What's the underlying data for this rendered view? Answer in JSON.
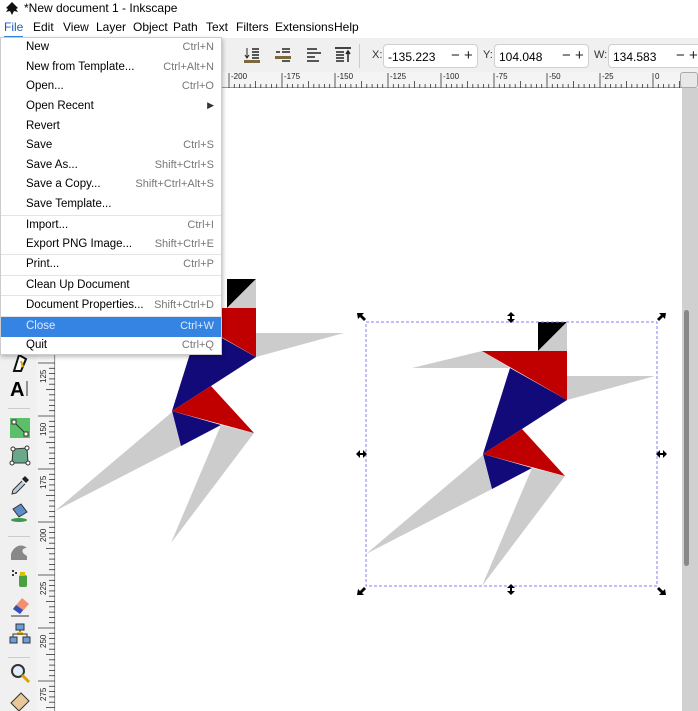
{
  "window": {
    "title": "*New document 1 - Inkscape"
  },
  "menubar": [
    "File",
    "Edit",
    "View",
    "Layer",
    "Object",
    "Path",
    "Text",
    "Filters",
    "Extensions",
    "Help"
  ],
  "file_menu": [
    {
      "label": "New",
      "shortcut": "Ctrl+N"
    },
    {
      "label": "New from Template...",
      "shortcut": "Ctrl+Alt+N"
    },
    {
      "label": "Open...",
      "shortcut": "Ctrl+O"
    },
    {
      "label": "Open Recent",
      "shortcut": "▶"
    },
    {
      "label": "Revert",
      "shortcut": ""
    },
    {
      "label": "Save",
      "shortcut": "Ctrl+S"
    },
    {
      "label": "Save As...",
      "shortcut": "Shift+Ctrl+S"
    },
    {
      "label": "Save a Copy...",
      "shortcut": "Shift+Ctrl+Alt+S"
    },
    {
      "label": "Save Template...",
      "shortcut": ""
    },
    {
      "label": "Import...",
      "shortcut": "Ctrl+I"
    },
    {
      "label": "Export PNG Image...",
      "shortcut": "Shift+Ctrl+E"
    },
    {
      "label": "Print...",
      "shortcut": "Ctrl+P"
    },
    {
      "label": "Clean Up Document",
      "shortcut": ""
    },
    {
      "label": "Document Properties...",
      "shortcut": "Shift+Ctrl+D"
    },
    {
      "label": "Close",
      "shortcut": "Ctrl+W"
    },
    {
      "label": "Quit",
      "shortcut": "Ctrl+Q"
    }
  ],
  "highlighted_item": "Close",
  "tool_controls": {
    "x": {
      "label": "X:",
      "value": "-135.223"
    },
    "y": {
      "label": "Y:",
      "value": "104.048"
    },
    "w": {
      "label": "W:",
      "value": "134.583"
    },
    "minus": "−",
    "plus": "+"
  },
  "hruler_labels": [
    "-200",
    "-175",
    "-150",
    "-125",
    "-100",
    "-75",
    "-50",
    "-25",
    "0"
  ],
  "vruler_labels": [
    "125",
    "150",
    "175",
    "200",
    "225",
    "250",
    "275"
  ],
  "colors": {
    "red": "#c00000",
    "blue": "#120a78",
    "gray": "#cccccc",
    "black": "#000000",
    "selection": "#8080ff",
    "highlight": "#3584e4"
  }
}
